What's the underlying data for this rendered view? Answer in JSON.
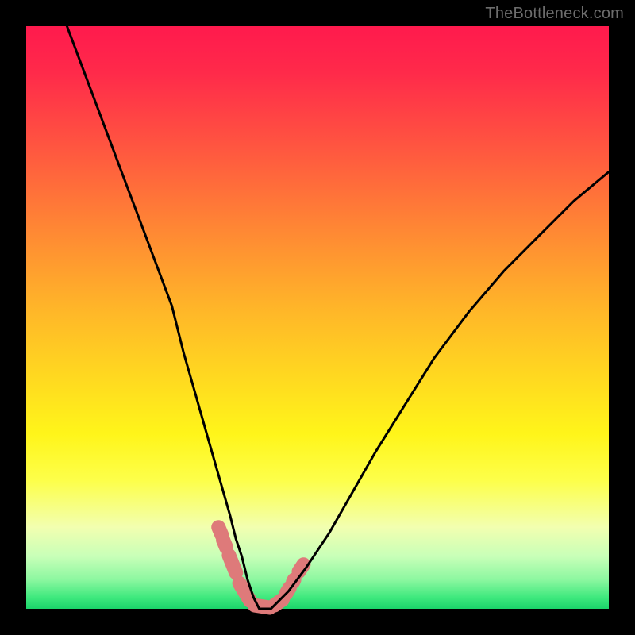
{
  "watermark": {
    "text": "TheBottleneck.com"
  },
  "chart_data": {
    "type": "line",
    "title": "",
    "xlabel": "",
    "ylabel": "",
    "xlim": [
      0,
      100
    ],
    "ylim": [
      0,
      100
    ],
    "series": [
      {
        "name": "curve",
        "x": [
          7,
          10,
          13,
          16,
          19,
          22,
          25,
          27,
          29,
          31,
          33,
          35,
          36,
          37,
          38,
          39,
          40,
          41,
          42,
          43,
          45,
          48,
          52,
          56,
          60,
          65,
          70,
          76,
          82,
          88,
          94,
          100
        ],
        "values": [
          100,
          92,
          84,
          76,
          68,
          60,
          52,
          44,
          37,
          30,
          23,
          16,
          12,
          9,
          5,
          2,
          0,
          0,
          0,
          1,
          3,
          7,
          13,
          20,
          27,
          35,
          43,
          51,
          58,
          64,
          70,
          75
        ]
      }
    ],
    "markers": {
      "color": "#de7a7a",
      "radius_px": 9,
      "capsules": [
        {
          "x1": 33.0,
          "y1": 14.0,
          "x2": 33.6,
          "y2": 12.6
        },
        {
          "x1": 33.8,
          "y1": 11.8,
          "x2": 34.3,
          "y2": 10.6
        },
        {
          "x1": 34.8,
          "y1": 9.2,
          "x2": 36.0,
          "y2": 6.2
        },
        {
          "x1": 36.6,
          "y1": 4.4,
          "x2": 38.4,
          "y2": 1.4
        },
        {
          "x1": 39.2,
          "y1": 0.6,
          "x2": 41.8,
          "y2": 0.2
        },
        {
          "x1": 42.6,
          "y1": 0.6,
          "x2": 44.0,
          "y2": 1.6
        },
        {
          "x1": 44.6,
          "y1": 2.6,
          "x2": 45.2,
          "y2": 3.6
        },
        {
          "x1": 45.8,
          "y1": 4.6,
          "x2": 46.0,
          "y2": 5.0
        },
        {
          "x1": 46.8,
          "y1": 6.4,
          "x2": 47.6,
          "y2": 7.6
        }
      ]
    }
  },
  "colors": {
    "curve_stroke": "#000000",
    "marker_fill": "#de7a7a"
  }
}
